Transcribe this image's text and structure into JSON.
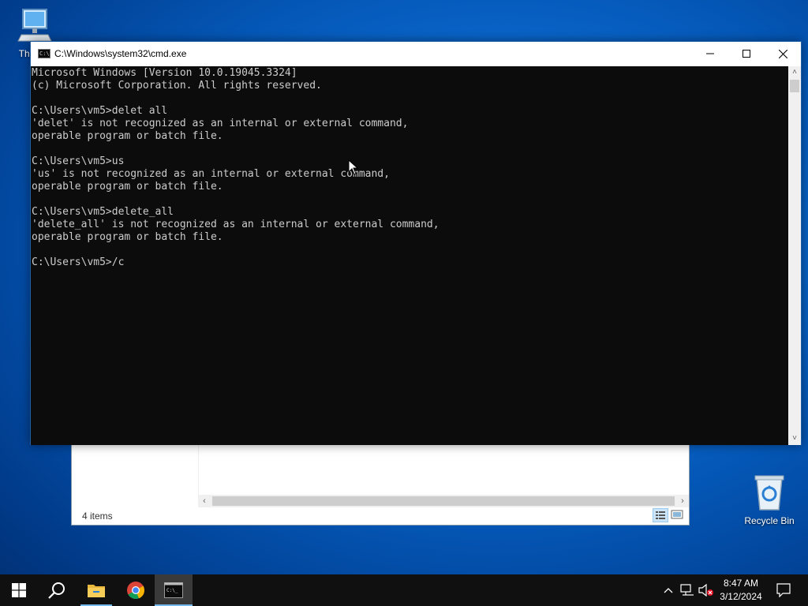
{
  "desktop": {
    "icons": [
      {
        "label": "This PC"
      },
      {
        "label": "Recycle Bin"
      }
    ]
  },
  "explorer": {
    "status_count": "4 items"
  },
  "cmd": {
    "title": "C:\\Windows\\system32\\cmd.exe",
    "output": "Microsoft Windows [Version 10.0.19045.3324]\n(c) Microsoft Corporation. All rights reserved.\n\nC:\\Users\\vm5>delet all\n'delet' is not recognized as an internal or external command,\noperable program or batch file.\n\nC:\\Users\\vm5>us\n'us' is not recognized as an internal or external command,\noperable program or batch file.\n\nC:\\Users\\vm5>delete_all\n'delete_all' is not recognized as an internal or external command,\noperable program or batch file.\n\nC:\\Users\\vm5>/c",
    "caption_buttons": [
      "minimize",
      "maximize",
      "close"
    ]
  },
  "taskbar": {
    "apps": [
      "start",
      "search",
      "file-explorer",
      "chrome",
      "cmd"
    ],
    "clock_time": "8:47 AM",
    "clock_date": "3/12/2024"
  },
  "colors": {
    "console_bg": "#0c0c0c",
    "console_fg": "#cccccc",
    "taskbar_bg": "#101010",
    "accent": "#76b9ed"
  }
}
